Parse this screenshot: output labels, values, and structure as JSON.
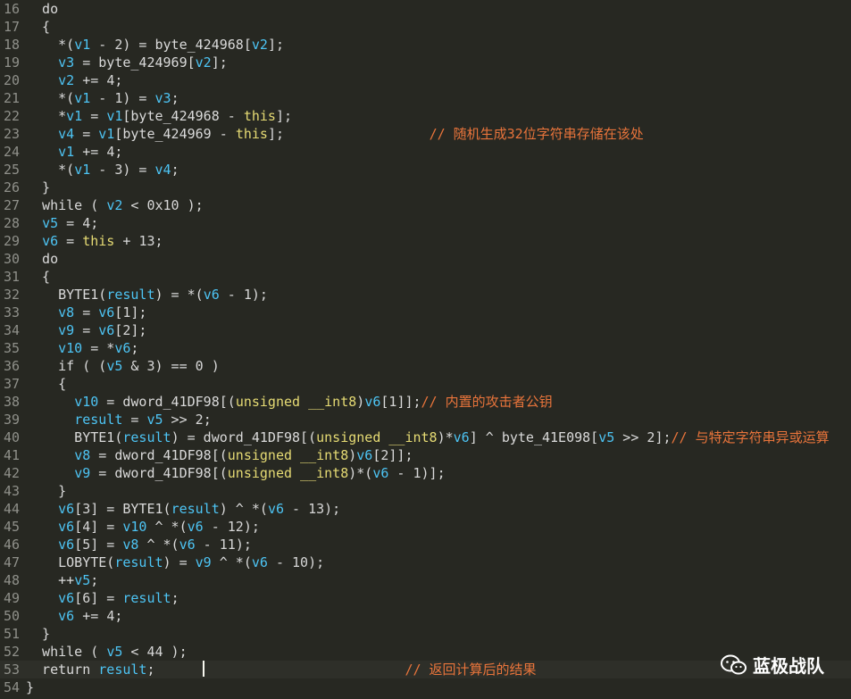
{
  "editor": {
    "lines": [
      {
        "no": "16",
        "tokens": [
          [
            "p",
            "  do"
          ]
        ]
      },
      {
        "no": "17",
        "tokens": [
          [
            "p",
            "  {"
          ]
        ]
      },
      {
        "no": "18",
        "tokens": [
          [
            "p",
            "    *("
          ],
          [
            "v",
            "v1"
          ],
          [
            "p",
            " - "
          ],
          [
            "n",
            "2"
          ],
          [
            "p",
            ") = byte_424968["
          ],
          [
            "v",
            "v2"
          ],
          [
            "p",
            "];"
          ]
        ]
      },
      {
        "no": "19",
        "tokens": [
          [
            "p",
            "    "
          ],
          [
            "v",
            "v3"
          ],
          [
            "p",
            " = byte_424969["
          ],
          [
            "v",
            "v2"
          ],
          [
            "p",
            "];"
          ]
        ]
      },
      {
        "no": "20",
        "tokens": [
          [
            "p",
            "    "
          ],
          [
            "v",
            "v2"
          ],
          [
            "p",
            " += "
          ],
          [
            "n",
            "4"
          ],
          [
            "p",
            ";"
          ]
        ]
      },
      {
        "no": "21",
        "tokens": [
          [
            "p",
            "    *("
          ],
          [
            "v",
            "v1"
          ],
          [
            "p",
            " - "
          ],
          [
            "n",
            "1"
          ],
          [
            "p",
            ") = "
          ],
          [
            "v",
            "v3"
          ],
          [
            "p",
            ";"
          ]
        ]
      },
      {
        "no": "22",
        "tokens": [
          [
            "p",
            "    *"
          ],
          [
            "v",
            "v1"
          ],
          [
            "p",
            " = "
          ],
          [
            "v",
            "v1"
          ],
          [
            "p",
            "[byte_424968 - "
          ],
          [
            "k",
            "this"
          ],
          [
            "p",
            "];"
          ]
        ]
      },
      {
        "no": "23",
        "tokens": [
          [
            "p",
            "    "
          ],
          [
            "v",
            "v4"
          ],
          [
            "p",
            " = "
          ],
          [
            "v",
            "v1"
          ],
          [
            "p",
            "[byte_424969 - "
          ],
          [
            "k",
            "this"
          ],
          [
            "p",
            "];                  "
          ],
          [
            "c",
            "// 随机生成32位字符串存储在该处"
          ]
        ]
      },
      {
        "no": "24",
        "tokens": [
          [
            "p",
            "    "
          ],
          [
            "v",
            "v1"
          ],
          [
            "p",
            " += "
          ],
          [
            "n",
            "4"
          ],
          [
            "p",
            ";"
          ]
        ]
      },
      {
        "no": "25",
        "tokens": [
          [
            "p",
            "    *("
          ],
          [
            "v",
            "v1"
          ],
          [
            "p",
            " - "
          ],
          [
            "n",
            "3"
          ],
          [
            "p",
            ") = "
          ],
          [
            "v",
            "v4"
          ],
          [
            "p",
            ";"
          ]
        ]
      },
      {
        "no": "26",
        "tokens": [
          [
            "p",
            "  }"
          ]
        ]
      },
      {
        "no": "27",
        "tokens": [
          [
            "p",
            "  while ( "
          ],
          [
            "v",
            "v2"
          ],
          [
            "p",
            " < "
          ],
          [
            "n",
            "0x10"
          ],
          [
            "p",
            " );"
          ]
        ]
      },
      {
        "no": "28",
        "tokens": [
          [
            "p",
            "  "
          ],
          [
            "v",
            "v5"
          ],
          [
            "p",
            " = "
          ],
          [
            "n",
            "4"
          ],
          [
            "p",
            ";"
          ]
        ]
      },
      {
        "no": "29",
        "tokens": [
          [
            "p",
            "  "
          ],
          [
            "v",
            "v6"
          ],
          [
            "p",
            " = "
          ],
          [
            "k",
            "this"
          ],
          [
            "p",
            " + "
          ],
          [
            "n",
            "13"
          ],
          [
            "p",
            ";"
          ]
        ]
      },
      {
        "no": "30",
        "tokens": [
          [
            "p",
            "  do"
          ]
        ]
      },
      {
        "no": "31",
        "tokens": [
          [
            "p",
            "  {"
          ]
        ]
      },
      {
        "no": "32",
        "tokens": [
          [
            "p",
            "    BYTE1("
          ],
          [
            "v",
            "result"
          ],
          [
            "p",
            ") = *("
          ],
          [
            "v",
            "v6"
          ],
          [
            "p",
            " - "
          ],
          [
            "n",
            "1"
          ],
          [
            "p",
            ");"
          ]
        ]
      },
      {
        "no": "33",
        "tokens": [
          [
            "p",
            "    "
          ],
          [
            "v",
            "v8"
          ],
          [
            "p",
            " = "
          ],
          [
            "v",
            "v6"
          ],
          [
            "p",
            "["
          ],
          [
            "n",
            "1"
          ],
          [
            "p",
            "];"
          ]
        ]
      },
      {
        "no": "34",
        "tokens": [
          [
            "p",
            "    "
          ],
          [
            "v",
            "v9"
          ],
          [
            "p",
            " = "
          ],
          [
            "v",
            "v6"
          ],
          [
            "p",
            "["
          ],
          [
            "n",
            "2"
          ],
          [
            "p",
            "];"
          ]
        ]
      },
      {
        "no": "35",
        "tokens": [
          [
            "p",
            "    "
          ],
          [
            "v",
            "v10"
          ],
          [
            "p",
            " = *"
          ],
          [
            "v",
            "v6"
          ],
          [
            "p",
            ";"
          ]
        ]
      },
      {
        "no": "36",
        "tokens": [
          [
            "p",
            "    if ( ("
          ],
          [
            "v",
            "v5"
          ],
          [
            "p",
            " & "
          ],
          [
            "n",
            "3"
          ],
          [
            "p",
            ") == "
          ],
          [
            "n",
            "0"
          ],
          [
            "p",
            " )"
          ]
        ]
      },
      {
        "no": "37",
        "tokens": [
          [
            "p",
            "    {"
          ]
        ]
      },
      {
        "no": "38",
        "tokens": [
          [
            "p",
            "      "
          ],
          [
            "v",
            "v10"
          ],
          [
            "p",
            " = dword_41DF98[("
          ],
          [
            "k",
            "unsigned __int8"
          ],
          [
            "p",
            ")"
          ],
          [
            "v",
            "v6"
          ],
          [
            "p",
            "["
          ],
          [
            "n",
            "1"
          ],
          [
            "p",
            "]];"
          ],
          [
            "c",
            "// 内置的攻击者公钥"
          ]
        ]
      },
      {
        "no": "39",
        "tokens": [
          [
            "p",
            "      "
          ],
          [
            "v",
            "result"
          ],
          [
            "p",
            " = "
          ],
          [
            "v",
            "v5"
          ],
          [
            "p",
            " >> "
          ],
          [
            "n",
            "2"
          ],
          [
            "p",
            ";"
          ]
        ]
      },
      {
        "no": "40",
        "tokens": [
          [
            "p",
            "      BYTE1("
          ],
          [
            "v",
            "result"
          ],
          [
            "p",
            ") = dword_41DF98[("
          ],
          [
            "k",
            "unsigned __int8"
          ],
          [
            "p",
            ")*"
          ],
          [
            "v",
            "v6"
          ],
          [
            "p",
            "] ^ byte_41E098["
          ],
          [
            "v",
            "v5"
          ],
          [
            "p",
            " >> "
          ],
          [
            "n",
            "2"
          ],
          [
            "p",
            "];"
          ],
          [
            "c",
            "// 与特定字符串异或运算"
          ]
        ]
      },
      {
        "no": "41",
        "tokens": [
          [
            "p",
            "      "
          ],
          [
            "v",
            "v8"
          ],
          [
            "p",
            " = dword_41DF98[("
          ],
          [
            "k",
            "unsigned __int8"
          ],
          [
            "p",
            ")"
          ],
          [
            "v",
            "v6"
          ],
          [
            "p",
            "["
          ],
          [
            "n",
            "2"
          ],
          [
            "p",
            "]];"
          ]
        ]
      },
      {
        "no": "42",
        "tokens": [
          [
            "p",
            "      "
          ],
          [
            "v",
            "v9"
          ],
          [
            "p",
            " = dword_41DF98[("
          ],
          [
            "k",
            "unsigned __int8"
          ],
          [
            "p",
            ")*("
          ],
          [
            "v",
            "v6"
          ],
          [
            "p",
            " - "
          ],
          [
            "n",
            "1"
          ],
          [
            "p",
            ")];"
          ]
        ]
      },
      {
        "no": "43",
        "tokens": [
          [
            "p",
            "    }"
          ]
        ]
      },
      {
        "no": "44",
        "tokens": [
          [
            "p",
            "    "
          ],
          [
            "v",
            "v6"
          ],
          [
            "p",
            "["
          ],
          [
            "n",
            "3"
          ],
          [
            "p",
            "] = BYTE1("
          ],
          [
            "v",
            "result"
          ],
          [
            "p",
            ") ^ *("
          ],
          [
            "v",
            "v6"
          ],
          [
            "p",
            " - "
          ],
          [
            "n",
            "13"
          ],
          [
            "p",
            ");"
          ]
        ]
      },
      {
        "no": "45",
        "tokens": [
          [
            "p",
            "    "
          ],
          [
            "v",
            "v6"
          ],
          [
            "p",
            "["
          ],
          [
            "n",
            "4"
          ],
          [
            "p",
            "] = "
          ],
          [
            "v",
            "v10"
          ],
          [
            "p",
            " ^ *("
          ],
          [
            "v",
            "v6"
          ],
          [
            "p",
            " - "
          ],
          [
            "n",
            "12"
          ],
          [
            "p",
            ");"
          ]
        ]
      },
      {
        "no": "46",
        "tokens": [
          [
            "p",
            "    "
          ],
          [
            "v",
            "v6"
          ],
          [
            "p",
            "["
          ],
          [
            "n",
            "5"
          ],
          [
            "p",
            "] = "
          ],
          [
            "v",
            "v8"
          ],
          [
            "p",
            " ^ *("
          ],
          [
            "v",
            "v6"
          ],
          [
            "p",
            " - "
          ],
          [
            "n",
            "11"
          ],
          [
            "p",
            ");"
          ]
        ]
      },
      {
        "no": "47",
        "tokens": [
          [
            "p",
            "    LOBYTE("
          ],
          [
            "v",
            "result"
          ],
          [
            "p",
            ") = "
          ],
          [
            "v",
            "v9"
          ],
          [
            "p",
            " ^ *("
          ],
          [
            "v",
            "v6"
          ],
          [
            "p",
            " - "
          ],
          [
            "n",
            "10"
          ],
          [
            "p",
            ");"
          ]
        ]
      },
      {
        "no": "48",
        "tokens": [
          [
            "p",
            "    ++"
          ],
          [
            "v",
            "v5"
          ],
          [
            "p",
            ";"
          ]
        ]
      },
      {
        "no": "49",
        "tokens": [
          [
            "p",
            "    "
          ],
          [
            "v",
            "v6"
          ],
          [
            "p",
            "["
          ],
          [
            "n",
            "6"
          ],
          [
            "p",
            "] = "
          ],
          [
            "v",
            "result"
          ],
          [
            "p",
            ";"
          ]
        ]
      },
      {
        "no": "50",
        "tokens": [
          [
            "p",
            "    "
          ],
          [
            "v",
            "v6"
          ],
          [
            "p",
            " += "
          ],
          [
            "n",
            "4"
          ],
          [
            "p",
            ";"
          ]
        ]
      },
      {
        "no": "51",
        "tokens": [
          [
            "p",
            "  }"
          ]
        ]
      },
      {
        "no": "52",
        "tokens": [
          [
            "p",
            "  while ( "
          ],
          [
            "v",
            "v5"
          ],
          [
            "p",
            " < "
          ],
          [
            "n",
            "44"
          ],
          [
            "p",
            " );"
          ]
        ]
      },
      {
        "no": "53",
        "tokens": [
          [
            "p",
            "  return "
          ],
          [
            "v",
            "result"
          ],
          [
            "p",
            ";                               "
          ],
          [
            "c",
            "// 返回计算后的结果"
          ]
        ]
      },
      {
        "no": "54",
        "tokens": [
          [
            "p",
            "}"
          ]
        ]
      }
    ],
    "current_line": "53"
  },
  "watermark": {
    "text": "蓝极战队",
    "icon": "wechat-icon"
  },
  "colors": {
    "background": "#272822",
    "line_number": "#8f908a",
    "variable": "#4dc4f4",
    "keyword": "#e6db74",
    "comment": "#e8743b",
    "plain": "#dadada"
  }
}
